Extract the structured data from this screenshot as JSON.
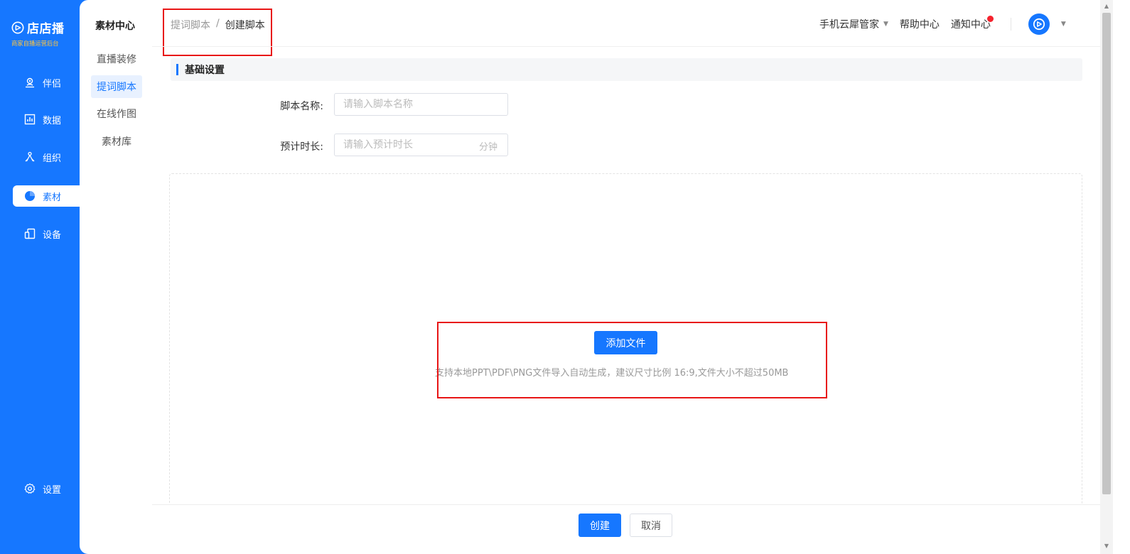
{
  "brand": {
    "name": "店店播",
    "subtitle": "商家自播运营后台"
  },
  "sidebar": {
    "items": [
      {
        "label": "伴侣",
        "icon": "companion-icon"
      },
      {
        "label": "数据",
        "icon": "chart-icon"
      },
      {
        "label": "组织",
        "icon": "organization-icon"
      },
      {
        "label": "素材",
        "icon": "material-icon",
        "active": true
      },
      {
        "label": "设备",
        "icon": "device-icon"
      }
    ],
    "settings_label": "设置"
  },
  "subnav": {
    "title": "素材中心",
    "items": [
      {
        "label": "直播装修"
      },
      {
        "label": "提词脚本",
        "active": true
      },
      {
        "label": "在线作图"
      },
      {
        "label": "素材库"
      }
    ]
  },
  "breadcrumb": {
    "parent": "提词脚本",
    "separator": "/",
    "current": "创建脚本"
  },
  "topbar": {
    "phone_manager": "手机云犀管家",
    "help": "帮助中心",
    "notifications": "通知中心"
  },
  "section": {
    "title": "基础设置"
  },
  "form": {
    "script_name_label": "脚本名称:",
    "script_name_placeholder": "请输入脚本名称",
    "script_name_value": "",
    "duration_label": "预计时长:",
    "duration_placeholder": "请输入预计时长",
    "duration_value": "",
    "duration_unit": "分钟"
  },
  "upload": {
    "button_label": "添加文件",
    "hint": "支持本地PPT\\PDF\\PNG文件导入自动生成，建议尺寸比例 16:9,文件大小不超过50MB"
  },
  "footer": {
    "create_label": "创建",
    "cancel_label": "取消"
  },
  "colors": {
    "primary": "#1677ff",
    "highlight": "#e81515",
    "brand_sub": "#ffc53d"
  }
}
